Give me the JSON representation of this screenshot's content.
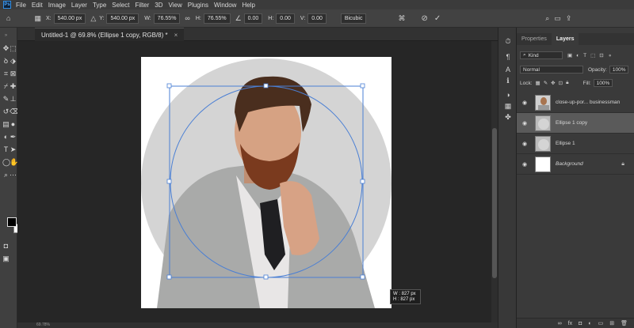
{
  "app": {
    "logo": "Ps"
  },
  "menu": [
    "File",
    "Edit",
    "Image",
    "Layer",
    "Type",
    "Select",
    "Filter",
    "3D",
    "View",
    "Plugins",
    "Window",
    "Help"
  ],
  "options_bar": {
    "x_label": "X:",
    "x_value": "540.00 px",
    "y_label": "Y:",
    "y_value": "540.00 px",
    "w_label": "W:",
    "w_value": "76.55%",
    "h_label": "H:",
    "h_value": "76.55%",
    "angle_value": "0.00",
    "hskew_label": "H:",
    "hskew_value": "0.00",
    "vskew_label": "V:",
    "vskew_value": "0.00",
    "interpolation": "Bicubic"
  },
  "document_tab": {
    "title": "Untitled-1 @ 69.8% (Ellipse 1 copy, RGB/8) *",
    "close": "×"
  },
  "transform_tooltip": {
    "w": "W : 827 px",
    "h": "H : 827 px"
  },
  "panels": {
    "tabs": [
      "Properties",
      "Layers"
    ],
    "active_tab": "Layers",
    "kind_label": "Kind",
    "blend_mode": "Normal",
    "opacity_label": "Opacity:",
    "opacity_value": "100%",
    "lock_label": "Lock:",
    "fill_label": "Fill:",
    "fill_value": "100%"
  },
  "layers": [
    {
      "name": "close-up-por... businessman",
      "selected": false,
      "locked": false
    },
    {
      "name": "Ellipse 1 copy",
      "selected": true,
      "locked": false
    },
    {
      "name": "Ellipse 1",
      "selected": false,
      "locked": false
    },
    {
      "name": "Background",
      "selected": false,
      "locked": true
    }
  ],
  "status_bar": {
    "zoom": "69.78%"
  },
  "colors": {
    "selection_blue": "#4a7fd4",
    "ellipse_gray": "#d4d4d4"
  }
}
